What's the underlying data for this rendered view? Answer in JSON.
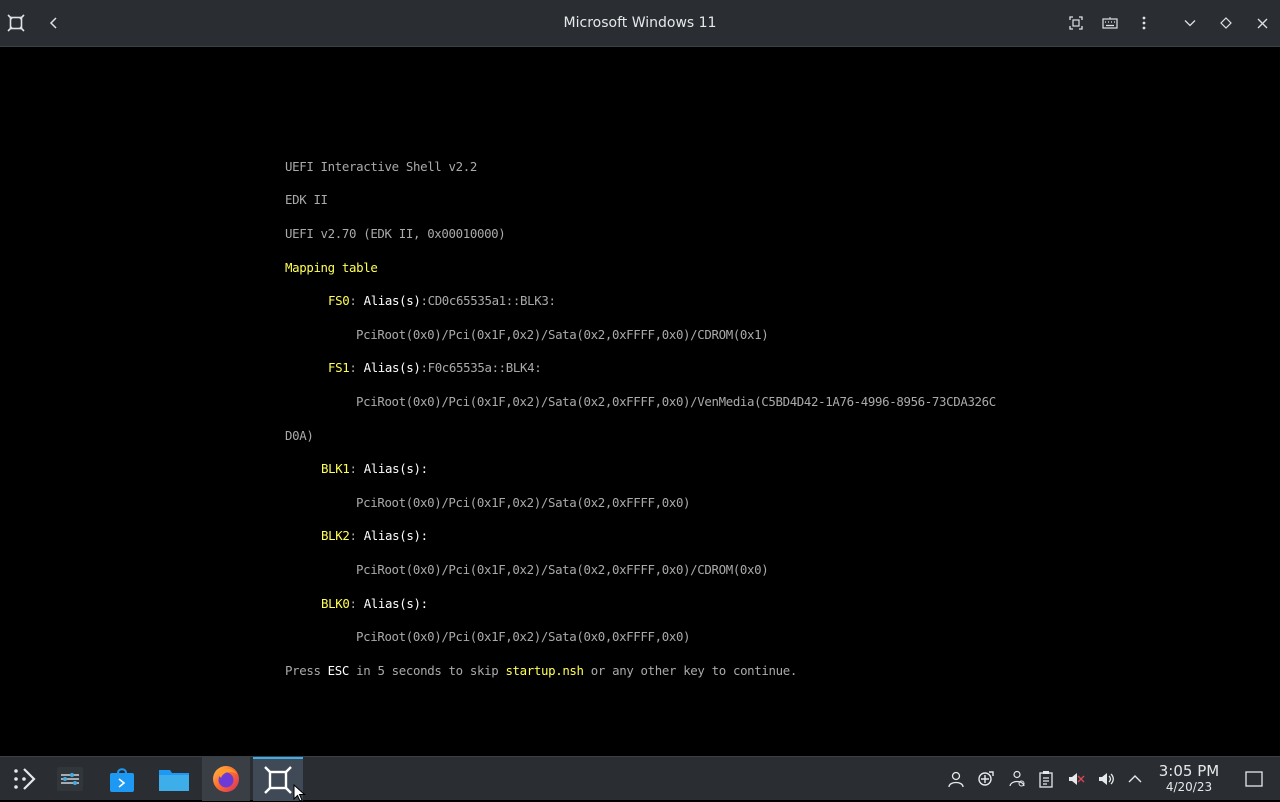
{
  "window": {
    "title": "Microsoft Windows 11",
    "icons": [
      "vm-app-icon",
      "back-icon",
      "fullscreen-icon",
      "keyboard-icon",
      "more-options-icon",
      "minimize-icon",
      "maximize-icon",
      "close-icon"
    ]
  },
  "console": {
    "line1": "UEFI Interactive Shell v2.2",
    "line2": "EDK II",
    "line3": "UEFI v2.70 (EDK II, 0x00010000)",
    "mapping_title": "Mapping table",
    "fs0_name": "FS0",
    "fs0_sep": ": ",
    "fs0_alias_label": "Alias(s)",
    "fs0_alias": ":CD0c65535a1::BLK3:",
    "fs0_path": "PciRoot(0x0)/Pci(0x1F,0x2)/Sata(0x2,0xFFFF,0x0)/CDROM(0x1)",
    "fs1_name": "FS1",
    "fs1_sep": ": ",
    "fs1_alias_label": "Alias(s)",
    "fs1_alias": ":F0c65535a::BLK4:",
    "fs1_path": "PciRoot(0x0)/Pci(0x1F,0x2)/Sata(0x2,0xFFFF,0x0)/VenMedia(C5BD4D42-1A76-4996-8956-73CDA326C",
    "fs1_path_wrap": "D0A)",
    "blk1_name": "BLK1",
    "blk1_sep": ": ",
    "blk1_alias_label": "Alias(s):",
    "blk1_path": "PciRoot(0x0)/Pci(0x1F,0x2)/Sata(0x2,0xFFFF,0x0)",
    "blk2_name": "BLK2",
    "blk2_sep": ": ",
    "blk2_alias_label": "Alias(s):",
    "blk2_path": "PciRoot(0x0)/Pci(0x1F,0x2)/Sata(0x2,0xFFFF,0x0)/CDROM(0x0)",
    "blk0_name": "BLK0",
    "blk0_sep": ": ",
    "blk0_alias_label": "Alias(s):",
    "blk0_path": "PciRoot(0x0)/Pci(0x1F,0x2)/Sata(0x0,0xFFFF,0x0)",
    "press_prefix": "Press ",
    "press_esc": "ESC",
    "press_mid": " in 5 seconds to skip ",
    "press_file": "startup.nsh",
    "press_suffix": " or any other key to continue.",
    "colors": {
      "text": "#aaaaaa",
      "highlight": "#ffff55",
      "bright": "#ffffff"
    }
  },
  "taskbar": {
    "apps": [
      "app-launcher-icon",
      "system-settings-icon",
      "discover-store-icon",
      "file-manager-icon",
      "firefox-icon",
      "gnome-boxes-icon"
    ],
    "tray": [
      "user-icon",
      "network-share-icon",
      "accessibility-icon",
      "clipboard-icon",
      "audio-muted-icon",
      "volume-icon",
      "expand-tray-icon"
    ],
    "clock_time": "3:05 PM",
    "clock_date": "4/20/23",
    "show_desktop": "show-desktop-icon",
    "accent": "#3daee9"
  }
}
